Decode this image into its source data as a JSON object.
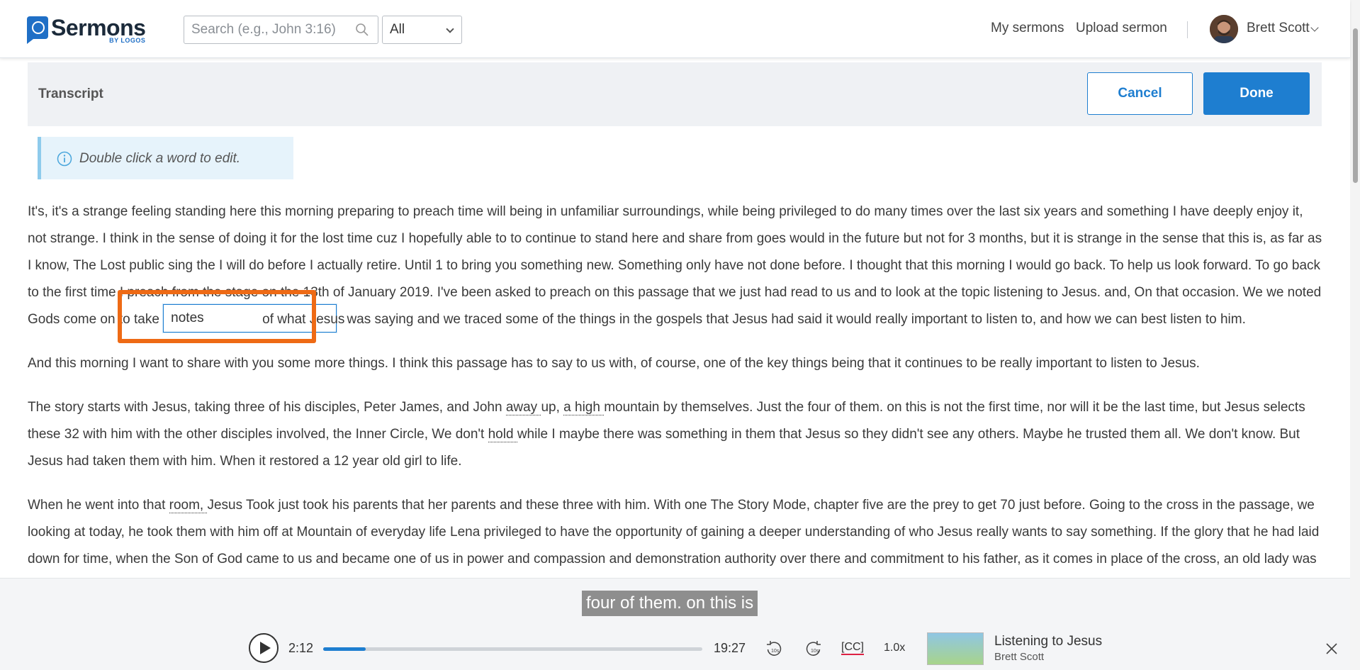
{
  "header": {
    "logo_text": "Sermons",
    "logo_sub": "BY LOGOS",
    "search_placeholder": "Search (e.g., John 3:16)",
    "filter_value": "All",
    "nav": [
      "My sermons",
      "Upload sermon"
    ],
    "user_name": "Brett Scott"
  },
  "toolbar": {
    "title": "Transcript",
    "cancel_label": "Cancel",
    "done_label": "Done"
  },
  "info": {
    "text": "Double click a word to edit."
  },
  "transcript": {
    "p1_a": "It's, it's a strange feeling standing here this morning preparing to preach time will being in unfamiliar surroundings, while being privileged to do many times over the last six years and something I have deeply enjoy it, not strange. I think in the sense of doing it for the lost time cuz I hopefully able to to continue to stand here and share from goes would in the future but not for 3 months, but it is strange in the sense that this is, as far as I know, The Lost public sing the I will do before I actually retire. Until 1 to bring you something new. Something only have not done before. I thought that this morning I would go back. To help us look forward. To go back to the first time I preach from the stage on the 13th of January 2019. I've been asked to preach on this passage that we just had read to us and to look at the topic listening to Jesus. and, On that occasion. We we noted Gods come on to take ",
    "edit_value": "notes",
    "edit_rest": "of what Jesus",
    "p1_b": " was saying and we traced some of the things in the gospels that Jesus had said it would really important to listen to, and how we can best listen to him.",
    "p2": "And this morning I want to share with you some more things. I think this passage has to say to us with, of course, one of the key things being that it continues to be really important to listen to Jesus.",
    "p3_a": "The story starts with Jesus, taking three of his disciples, Peter James, and John ",
    "p3_u1": "away ",
    "p3_b": "up, ",
    "p3_u2": "a high ",
    "p3_c": "mountain by themselves. Just the four of them. on this is not the first time, nor will it be the last time, but Jesus selects these 32 with him with the other disciples involved, the Inner Circle, We don't ",
    "p3_u3": "hold ",
    "p3_d": "while I maybe there was something in them that Jesus so they didn't see any others. Maybe he trusted them all. We don't know. But Jesus had taken them with him. When it restored a 12 year old girl to life.",
    "p4_a": "When he went into that ",
    "p4_u1": "room, ",
    "p4_b": "Jesus Took just took his parents that her parents and these three with him. With one The Story Mode, chapter five are the prey to get 70 just before. Going to the cross in the passage, we looking at today, he took them with him off at Mountain of everyday life Lena privileged to have the opportunity of gaining a deeper understanding of who Jesus really wants to say something. If the glory that he had laid down for time, when the Son of God came to us and became one of us in power and compassion and demonstration authority over there and commitment to his father, as it comes in place of the cross, an old lady was"
  },
  "player": {
    "caption": "four of them. on this is",
    "current_time": "2:12",
    "duration": "19:27",
    "progress": 0.113,
    "skip_back": "10s",
    "skip_forward": "10s",
    "cc_label": "[CC]",
    "speed": "1.0x",
    "sermon_title": "Listening to Jesus",
    "sermon_author": "Brett Scott"
  },
  "colors": {
    "accent": "#1e7ed0",
    "highlight": "#ee6a15"
  }
}
